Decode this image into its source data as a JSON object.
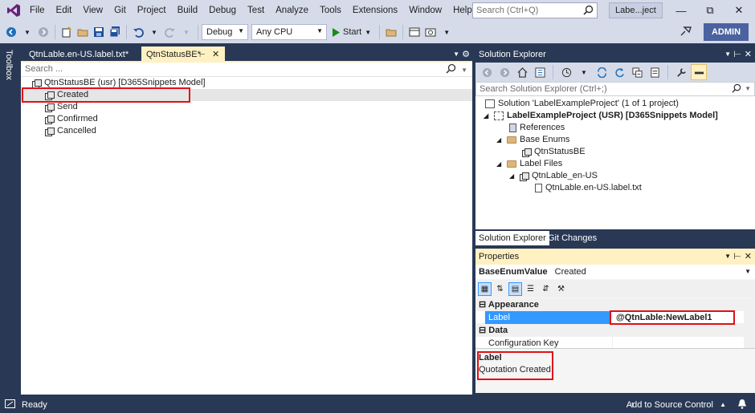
{
  "menu": {
    "items": [
      "File",
      "Edit",
      "View",
      "Git",
      "Project",
      "Build",
      "Debug",
      "Test",
      "Analyze",
      "Tools",
      "Extensions",
      "Window",
      "Help"
    ],
    "search_placeholder": "Search (Ctrl+Q)",
    "project_badge": "Labe...ject"
  },
  "toolbar": {
    "config": "Debug",
    "platform": "Any CPU",
    "start_label": "Start",
    "admin_label": "ADMIN"
  },
  "toolbox": {
    "label": "Toolbox"
  },
  "editor": {
    "tabs": [
      {
        "label": "QtnLable.en-US.label.txt*"
      },
      {
        "label": "QtnStatusBE*"
      }
    ],
    "search_placeholder": "Search ...",
    "root": "QtnStatusBE (usr) [D365Snippets Model]",
    "values": [
      "Created",
      "Send",
      "Confirmed",
      "Cancelled"
    ]
  },
  "solution_explorer": {
    "title": "Solution Explorer",
    "search_placeholder": "Search Solution Explorer (Ctrl+;)",
    "solution": "Solution 'LabelExampleProject' (1 of 1 project)",
    "project": "LabelExampleProject (USR) [D365Snippets Model]",
    "references": "References",
    "base_enums": "Base Enums",
    "base_enum_item": "QtnStatusBE",
    "label_files": "Label Files",
    "label_file": "QtnLable_en-US",
    "label_txt": "QtnLable.en-US.label.txt",
    "tabs": [
      "Solution Explorer",
      "Git Changes"
    ]
  },
  "properties": {
    "title": "Properties",
    "object_type": "BaseEnumValue",
    "object_name": "Created",
    "categories": {
      "appearance": "Appearance",
      "data": "Data"
    },
    "rows": {
      "label_name": "Label",
      "label_value": "@QtnLable:NewLabel1",
      "config_key_name": "Configuration Key",
      "config_key_value": ""
    },
    "desc_title": "Label",
    "desc_text": "Quotation Created"
  },
  "status": {
    "ready": "Ready",
    "source_control": "Add to Source Control"
  },
  "colors": {
    "chrome": "#293955",
    "menu_bg": "#d6dbe9",
    "active_tab": "#fff1c2",
    "highlight": "#e0101a",
    "selection": "#3399ff"
  }
}
